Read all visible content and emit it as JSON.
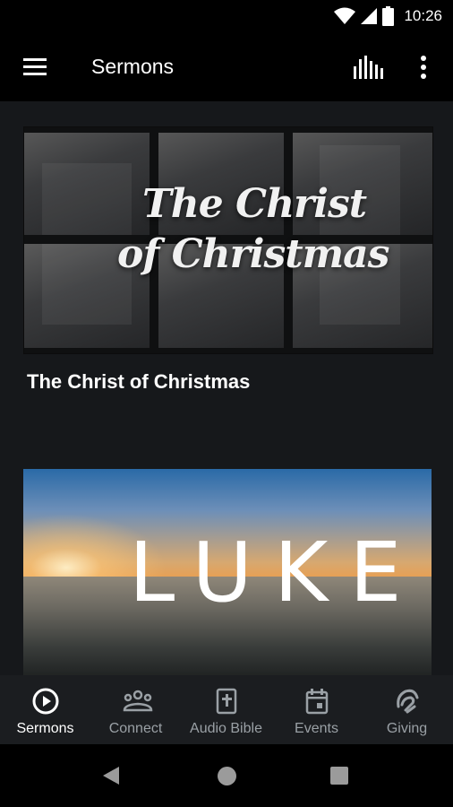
{
  "status": {
    "time": "10:26",
    "icons": [
      "wifi-icon",
      "signal-icon",
      "battery-icon"
    ]
  },
  "appbar": {
    "title": "Sermons",
    "menu_icon": "hamburger-menu-icon",
    "equalizer_icon": "equalizer-icon",
    "more_icon": "more-vert-icon"
  },
  "sermons": [
    {
      "image_text_line1": "The Christ",
      "image_text_line2": "of Christmas",
      "title": "The Christ of Christmas"
    },
    {
      "image_text": "LUKE"
    }
  ],
  "nav": [
    {
      "label": "Sermons",
      "icon": "play-circle-icon",
      "active": true
    },
    {
      "label": "Connect",
      "icon": "group-icon",
      "active": false
    },
    {
      "label": "Audio Bible",
      "icon": "bible-icon",
      "active": false
    },
    {
      "label": "Events",
      "icon": "calendar-icon",
      "active": false
    },
    {
      "label": "Giving",
      "icon": "giving-hand-icon",
      "active": false
    }
  ],
  "colors": {
    "background": "#16181b",
    "appbar": "#000000",
    "nav_background": "#1b1d20",
    "nav_inactive": "#9aa0a5",
    "nav_active": "#ffffff"
  }
}
